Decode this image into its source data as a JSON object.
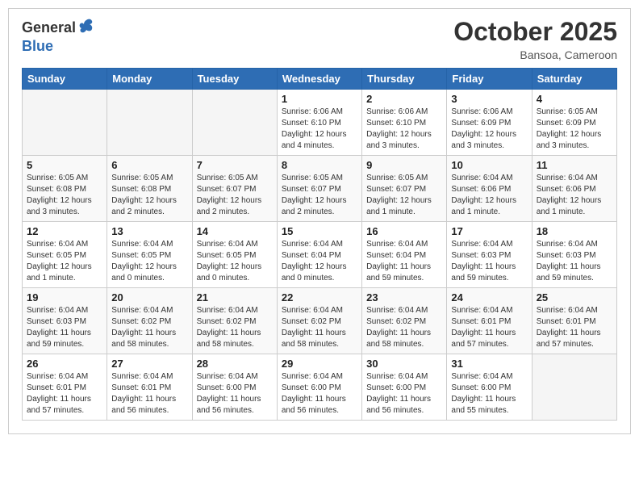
{
  "header": {
    "logo_general": "General",
    "logo_blue": "Blue",
    "month": "October 2025",
    "location": "Bansoa, Cameroon"
  },
  "weekdays": [
    "Sunday",
    "Monday",
    "Tuesday",
    "Wednesday",
    "Thursday",
    "Friday",
    "Saturday"
  ],
  "weeks": [
    [
      {
        "day": "",
        "info": ""
      },
      {
        "day": "",
        "info": ""
      },
      {
        "day": "",
        "info": ""
      },
      {
        "day": "1",
        "info": "Sunrise: 6:06 AM\nSunset: 6:10 PM\nDaylight: 12 hours\nand 4 minutes."
      },
      {
        "day": "2",
        "info": "Sunrise: 6:06 AM\nSunset: 6:10 PM\nDaylight: 12 hours\nand 3 minutes."
      },
      {
        "day": "3",
        "info": "Sunrise: 6:06 AM\nSunset: 6:09 PM\nDaylight: 12 hours\nand 3 minutes."
      },
      {
        "day": "4",
        "info": "Sunrise: 6:05 AM\nSunset: 6:09 PM\nDaylight: 12 hours\nand 3 minutes."
      }
    ],
    [
      {
        "day": "5",
        "info": "Sunrise: 6:05 AM\nSunset: 6:08 PM\nDaylight: 12 hours\nand 3 minutes."
      },
      {
        "day": "6",
        "info": "Sunrise: 6:05 AM\nSunset: 6:08 PM\nDaylight: 12 hours\nand 2 minutes."
      },
      {
        "day": "7",
        "info": "Sunrise: 6:05 AM\nSunset: 6:07 PM\nDaylight: 12 hours\nand 2 minutes."
      },
      {
        "day": "8",
        "info": "Sunrise: 6:05 AM\nSunset: 6:07 PM\nDaylight: 12 hours\nand 2 minutes."
      },
      {
        "day": "9",
        "info": "Sunrise: 6:05 AM\nSunset: 6:07 PM\nDaylight: 12 hours\nand 1 minute."
      },
      {
        "day": "10",
        "info": "Sunrise: 6:04 AM\nSunset: 6:06 PM\nDaylight: 12 hours\nand 1 minute."
      },
      {
        "day": "11",
        "info": "Sunrise: 6:04 AM\nSunset: 6:06 PM\nDaylight: 12 hours\nand 1 minute."
      }
    ],
    [
      {
        "day": "12",
        "info": "Sunrise: 6:04 AM\nSunset: 6:05 PM\nDaylight: 12 hours\nand 1 minute."
      },
      {
        "day": "13",
        "info": "Sunrise: 6:04 AM\nSunset: 6:05 PM\nDaylight: 12 hours\nand 0 minutes."
      },
      {
        "day": "14",
        "info": "Sunrise: 6:04 AM\nSunset: 6:05 PM\nDaylight: 12 hours\nand 0 minutes."
      },
      {
        "day": "15",
        "info": "Sunrise: 6:04 AM\nSunset: 6:04 PM\nDaylight: 12 hours\nand 0 minutes."
      },
      {
        "day": "16",
        "info": "Sunrise: 6:04 AM\nSunset: 6:04 PM\nDaylight: 11 hours\nand 59 minutes."
      },
      {
        "day": "17",
        "info": "Sunrise: 6:04 AM\nSunset: 6:03 PM\nDaylight: 11 hours\nand 59 minutes."
      },
      {
        "day": "18",
        "info": "Sunrise: 6:04 AM\nSunset: 6:03 PM\nDaylight: 11 hours\nand 59 minutes."
      }
    ],
    [
      {
        "day": "19",
        "info": "Sunrise: 6:04 AM\nSunset: 6:03 PM\nDaylight: 11 hours\nand 59 minutes."
      },
      {
        "day": "20",
        "info": "Sunrise: 6:04 AM\nSunset: 6:02 PM\nDaylight: 11 hours\nand 58 minutes."
      },
      {
        "day": "21",
        "info": "Sunrise: 6:04 AM\nSunset: 6:02 PM\nDaylight: 11 hours\nand 58 minutes."
      },
      {
        "day": "22",
        "info": "Sunrise: 6:04 AM\nSunset: 6:02 PM\nDaylight: 11 hours\nand 58 minutes."
      },
      {
        "day": "23",
        "info": "Sunrise: 6:04 AM\nSunset: 6:02 PM\nDaylight: 11 hours\nand 58 minutes."
      },
      {
        "day": "24",
        "info": "Sunrise: 6:04 AM\nSunset: 6:01 PM\nDaylight: 11 hours\nand 57 minutes."
      },
      {
        "day": "25",
        "info": "Sunrise: 6:04 AM\nSunset: 6:01 PM\nDaylight: 11 hours\nand 57 minutes."
      }
    ],
    [
      {
        "day": "26",
        "info": "Sunrise: 6:04 AM\nSunset: 6:01 PM\nDaylight: 11 hours\nand 57 minutes."
      },
      {
        "day": "27",
        "info": "Sunrise: 6:04 AM\nSunset: 6:01 PM\nDaylight: 11 hours\nand 56 minutes."
      },
      {
        "day": "28",
        "info": "Sunrise: 6:04 AM\nSunset: 6:00 PM\nDaylight: 11 hours\nand 56 minutes."
      },
      {
        "day": "29",
        "info": "Sunrise: 6:04 AM\nSunset: 6:00 PM\nDaylight: 11 hours\nand 56 minutes."
      },
      {
        "day": "30",
        "info": "Sunrise: 6:04 AM\nSunset: 6:00 PM\nDaylight: 11 hours\nand 56 minutes."
      },
      {
        "day": "31",
        "info": "Sunrise: 6:04 AM\nSunset: 6:00 PM\nDaylight: 11 hours\nand 55 minutes."
      },
      {
        "day": "",
        "info": ""
      }
    ]
  ]
}
